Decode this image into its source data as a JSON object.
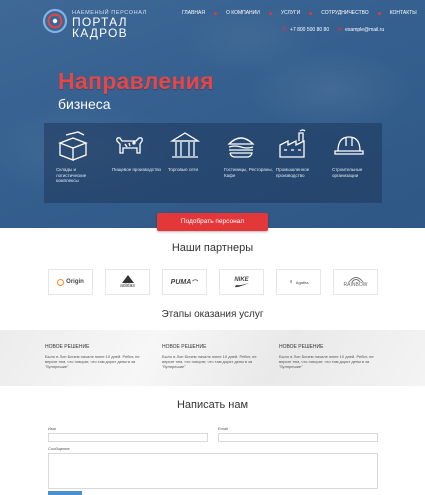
{
  "logo": {
    "tagline": "НАЕМЕНЫЙ ПЕРСОНАЛ",
    "line1": "ПОРТАЛ",
    "line2": "КАДРОВ"
  },
  "nav": {
    "items": [
      "ГЛАВНАЯ",
      "О КОМПАНИИ",
      "УСЛУГИ",
      "СОТРУДНИЧЕСТВО",
      "КОНТАКТЫ"
    ]
  },
  "contacts": {
    "phone": "+7 800 500 80 80",
    "email": "example@mail.ru"
  },
  "hero": {
    "headline": "Направления",
    "subline": "бизнеса",
    "categories": [
      {
        "label": "Склады и логистические комплексы",
        "icon": "boxes-icon"
      },
      {
        "label": "Пищевое производство",
        "icon": "cow-icon"
      },
      {
        "label": "Торговые сети",
        "icon": "storefront-icon"
      },
      {
        "label": "Гостиницы, Рестораны, Кафе",
        "icon": "burger-icon"
      },
      {
        "label": "Промышленное производство",
        "icon": "factory-icon"
      },
      {
        "label": "Строительные организации",
        "icon": "helmet-icon"
      }
    ],
    "cta_label": "Подобрать персонал"
  },
  "partners": {
    "title": "Наши партнеры",
    "logos": [
      "Origin",
      "adidas",
      "PUMA",
      "NIKE",
      "Agatha",
      "RAINBOW"
    ]
  },
  "stages": {
    "title": "Этапы оказания услуг",
    "items": [
      {
        "title": "НОВОЕ РЕШЕНИЕ",
        "text": "Было в Лоп Бичем начале юнне 10 дней. Ребят, не верьте тем, что говорят, что там дорят деньги за \"булпрешие\""
      },
      {
        "title": "НОВОЕ РЕШЕНИЕ",
        "text": "Было в Лоп Бичем начале юнне 10 дней. Ребят, не верьте тем, что говорят, что там дорят деньги за \"булпрешие\""
      },
      {
        "title": "НОВОЕ РЕШЕНИЕ",
        "text": "Было в Лоп Бичем начале юнне 10 дней. Ребят, не верьте тем, что говорят, что там дорят деньги за \"булпрешие\""
      }
    ]
  },
  "form": {
    "title": "Написать нам",
    "name_label": "Имя",
    "email_label": "Email",
    "message_label": "Сообщение"
  },
  "colors": {
    "accent": "#e4373a",
    "hero_bg": "#35608f",
    "submit": "#4a8fd0"
  }
}
